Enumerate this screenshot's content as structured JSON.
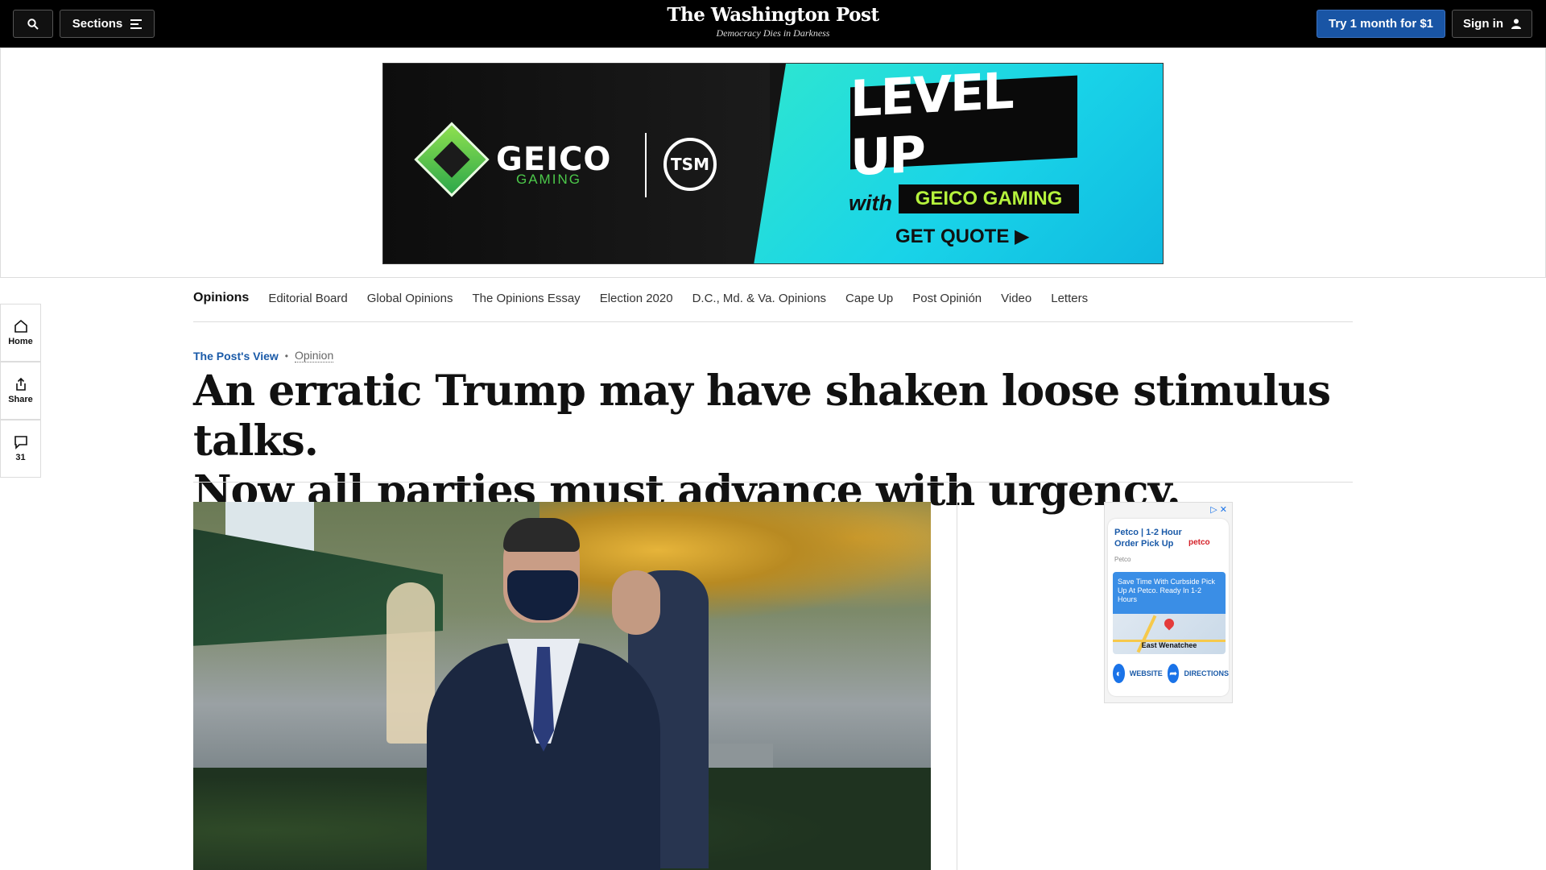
{
  "topbar": {
    "sections_label": "Sections",
    "logo_title": "The Washington Post",
    "logo_tagline": "Democracy Dies in Darkness",
    "try_label": "Try 1 month for $1",
    "signin_label": "Sign in"
  },
  "ad_banner": {
    "brand": "GEICO",
    "brand_sub": "GAMING",
    "partner": "TSM",
    "headline": "LEVEL UP",
    "with": "with",
    "product": "GEICO GAMING",
    "cta": "GET QUOTE ▶"
  },
  "rail": {
    "home_label": "Home",
    "share_label": "Share",
    "comments_count": "31"
  },
  "section_nav": [
    "Opinions",
    "Editorial Board",
    "Global Opinions",
    "The Opinions Essay",
    "Election 2020",
    "D.C., Md. & Va. Opinions",
    "Cape Up",
    "Post Opinión",
    "Video",
    "Letters"
  ],
  "article": {
    "kicker": "The Post's View",
    "category": "Opinion",
    "headline_line1": "An erratic Trump may have shaken loose stimulus talks.",
    "headline_line2": "Now all parties must advance with urgency."
  },
  "side_ad": {
    "title": "Petco | 1-2 Hour Order Pick Up",
    "brand": "petco",
    "advertiser": "Petco",
    "promo": "Save Time With Curbside Pick Up At Petco. Ready In 1-2 Hours",
    "city": "East Wenatchee",
    "website_label": "WEBSITE",
    "directions_label": "DIRECTIONS"
  },
  "colors": {
    "topbar": "#000000",
    "accent_blue": "#1955a5",
    "kicker_blue": "#1a5aa8"
  }
}
